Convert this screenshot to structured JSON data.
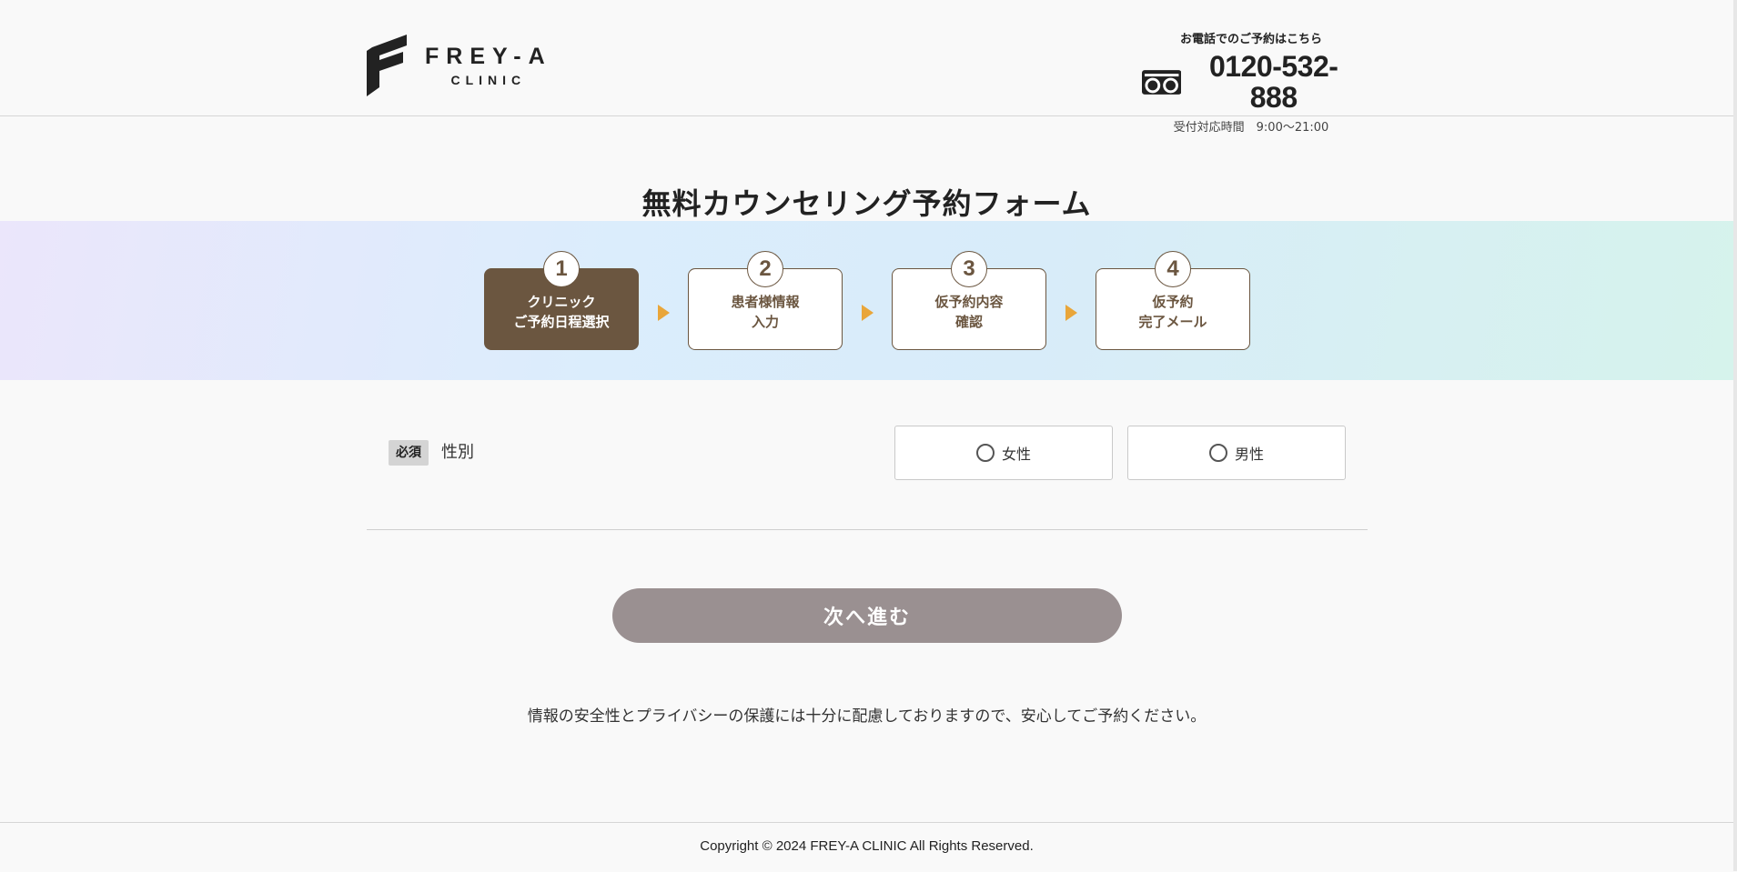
{
  "brand": {
    "name": "FREY-A",
    "sub": "CLINIC"
  },
  "contact": {
    "caption": "お電話でのご予約はこちら",
    "phone": "0120-532-888",
    "hours": "受付対応時間　9:00〜21:00"
  },
  "page": {
    "title": "無料カウンセリング予約フォーム"
  },
  "steps": [
    {
      "number": "1",
      "line1": "クリニック",
      "line2": "ご予約日程選択"
    },
    {
      "number": "2",
      "line1": "患者様情報",
      "line2": "入力"
    },
    {
      "number": "3",
      "line1": "仮予約内容",
      "line2": "確認"
    },
    {
      "number": "4",
      "line1": "仮予約",
      "line2": "完了メール"
    }
  ],
  "form": {
    "gender": {
      "required_badge": "必須",
      "label": "性別",
      "options": [
        {
          "label": "女性"
        },
        {
          "label": "男性"
        }
      ]
    },
    "next_label": "次へ進む"
  },
  "privacy_note": "情報の安全性とプライバシーの保護には十分に配慮しておりますので、安心してご予約ください。",
  "footer": {
    "copyright": "Copyright © 2024 FREY-A CLINIC All Rights Reserved."
  },
  "colors": {
    "brand_brown": "#6b5640",
    "step_arrow": "#e9a63a",
    "button_disabled": "#9a9091"
  }
}
